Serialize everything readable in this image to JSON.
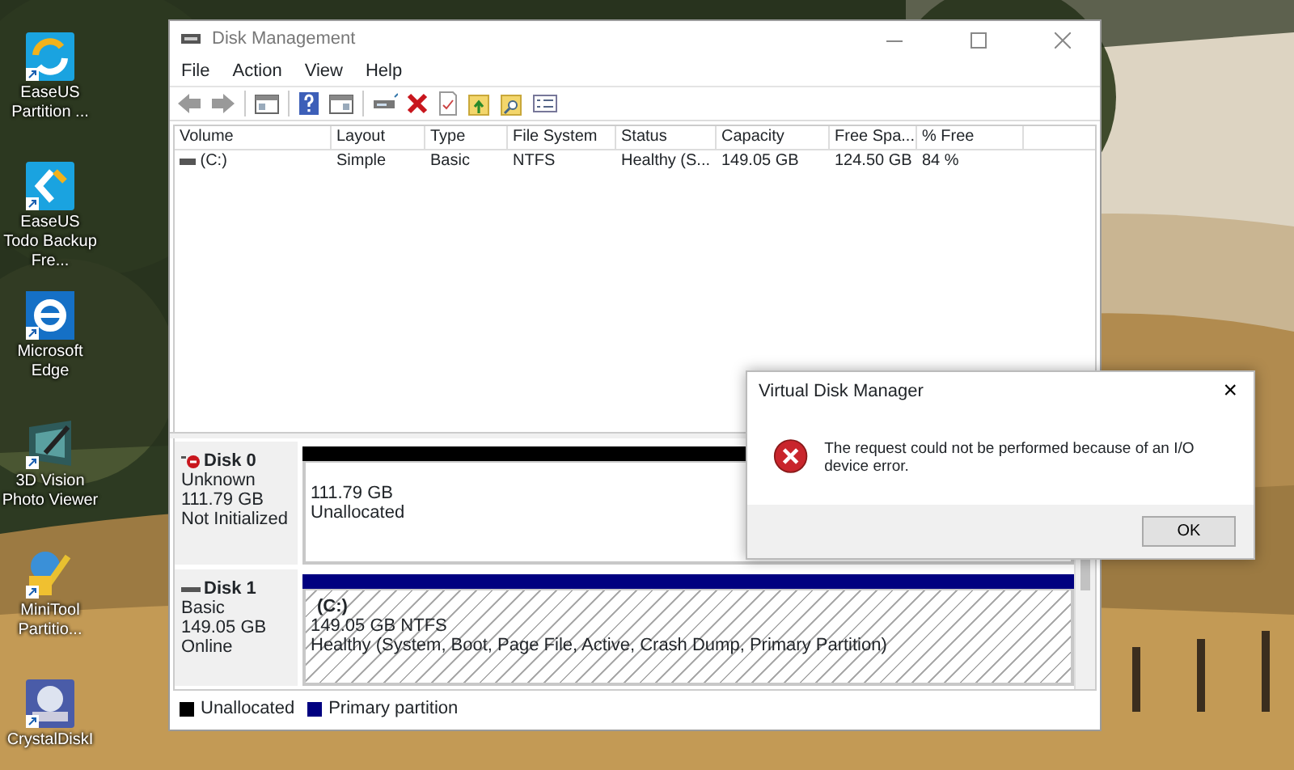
{
  "desktop_icons": [
    {
      "label": "EaseUS Partition ..."
    },
    {
      "label": "EaseUS Todo Backup Fre..."
    },
    {
      "label": "Microsoft Edge"
    },
    {
      "label": "3D Vision Photo Viewer"
    },
    {
      "label": "MiniTool Partitio..."
    },
    {
      "label": "CrystalDiskI"
    }
  ],
  "window": {
    "title": "Disk Management",
    "menu": [
      "File",
      "Action",
      "View",
      "Help"
    ],
    "volume_table": {
      "columns": [
        "Volume",
        "Layout",
        "Type",
        "File System",
        "Status",
        "Capacity",
        "Free Spa...",
        "% Free"
      ],
      "rows": [
        {
          "cells": [
            "(C:)",
            "Simple",
            "Basic",
            "NTFS",
            "Healthy (S...",
            "149.05 GB",
            "124.50 GB",
            "84 %"
          ]
        }
      ]
    },
    "disks": [
      {
        "name": "Disk 0",
        "kind": "error",
        "lines": [
          "Unknown",
          "111.79 GB",
          "Not Initialized"
        ],
        "partitions": [
          {
            "kind": "unallocated",
            "lines": [
              "111.79 GB",
              "Unallocated"
            ]
          }
        ]
      },
      {
        "name": "Disk 1",
        "kind": "online",
        "lines": [
          "Basic",
          "149.05 GB",
          "Online"
        ],
        "partitions": [
          {
            "kind": "primary",
            "name": "(C:)",
            "lines": [
              "149.05 GB NTFS",
              "Healthy (System, Boot, Page File, Active, Crash Dump, Primary Partition)"
            ]
          }
        ]
      }
    ],
    "legend": [
      {
        "label": "Unallocated",
        "color": "#000000"
      },
      {
        "label": "Primary partition",
        "color": "#000080"
      }
    ]
  },
  "dialog": {
    "title": "Virtual Disk Manager",
    "close": "×",
    "message": "The request could not be performed because of an I/O device error.",
    "buttons": [
      "OK"
    ]
  }
}
